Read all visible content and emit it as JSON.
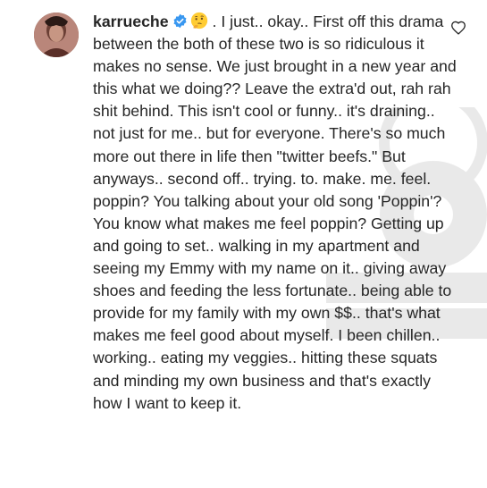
{
  "comment": {
    "username": "karrueche",
    "verified_icon": "verified-badge-icon",
    "emoji_icon": "thinking-face-emoji",
    "text": ". I just.. okay.. First off this drama between the both of these two is so ridiculous it makes no sense. We just brought in a new year and this what we doing?? Leave the extra'd out, rah rah  shit behind. This isn't cool or funny.. it's draining.. not just for me.. but for everyone. There's so much more out there in life then \"twitter beefs.\" But anyways.. second off.. trying. to. make. me. feel. poppin? You talking about your old song 'Poppin'? You know what makes me feel poppin? Getting up and going to set.. walking in my apartment and seeing my Emmy with my name on it.. giving away shoes and feeding the less fortunate.. being able to provide for my family with my own $$.. that's what makes me feel good about myself. I been chillen.. working.. eating my veggies.. hitting these squats and minding my own business and that's exactly how I want to keep it.",
    "like_icon": "heart-outline-icon"
  },
  "colors": {
    "text": "#262626",
    "verified": "#3897f0",
    "heart_stroke": "#262626",
    "background": "#ffffff"
  }
}
